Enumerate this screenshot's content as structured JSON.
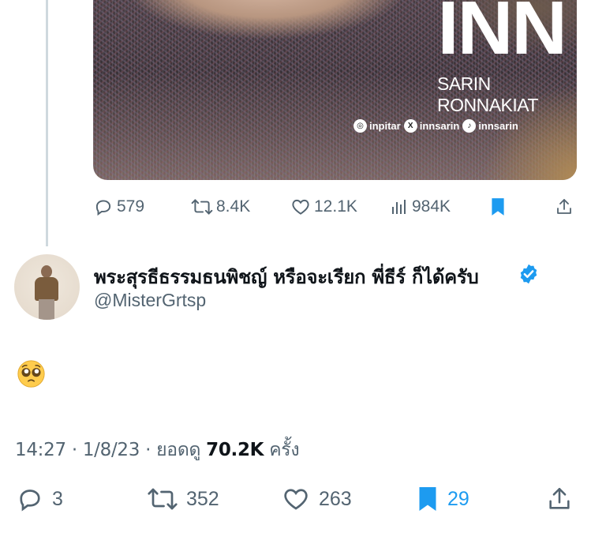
{
  "quoted_media": {
    "brand_title": "INN",
    "brand_subtitle": "SARIN RONNAKIAT",
    "socials": [
      {
        "icon": "instagram-icon",
        "handle": "inpitar"
      },
      {
        "icon": "x-logo-icon",
        "handle": "innsarin"
      },
      {
        "icon": "tiktok-icon",
        "handle": "innsarin"
      }
    ]
  },
  "parent_tweet_actions": {
    "replies": "579",
    "retweets": "8.4K",
    "likes": "12.1K",
    "views": "984K"
  },
  "tweet": {
    "author_name": "พระสุรธีธรรมธนพิชญ์ หรือจะเรียก พี่ธีร์ ก็ได้ครับ",
    "handle": "@MisterGrtsp",
    "verified": true,
    "body_emoji": "pleading-face",
    "time": "14:27",
    "date": "1/8/23",
    "views_label": "ยอดดู",
    "views_count": "70.2K",
    "views_suffix": "ครั้ง",
    "separator": "·"
  },
  "tweet_actions": {
    "replies": "3",
    "retweets": "352",
    "likes": "263",
    "bookmarks": "29"
  },
  "colors": {
    "accent": "#1d9bf0",
    "muted": "#536471",
    "text": "#0f1419",
    "thread_line": "#cfd9de"
  }
}
